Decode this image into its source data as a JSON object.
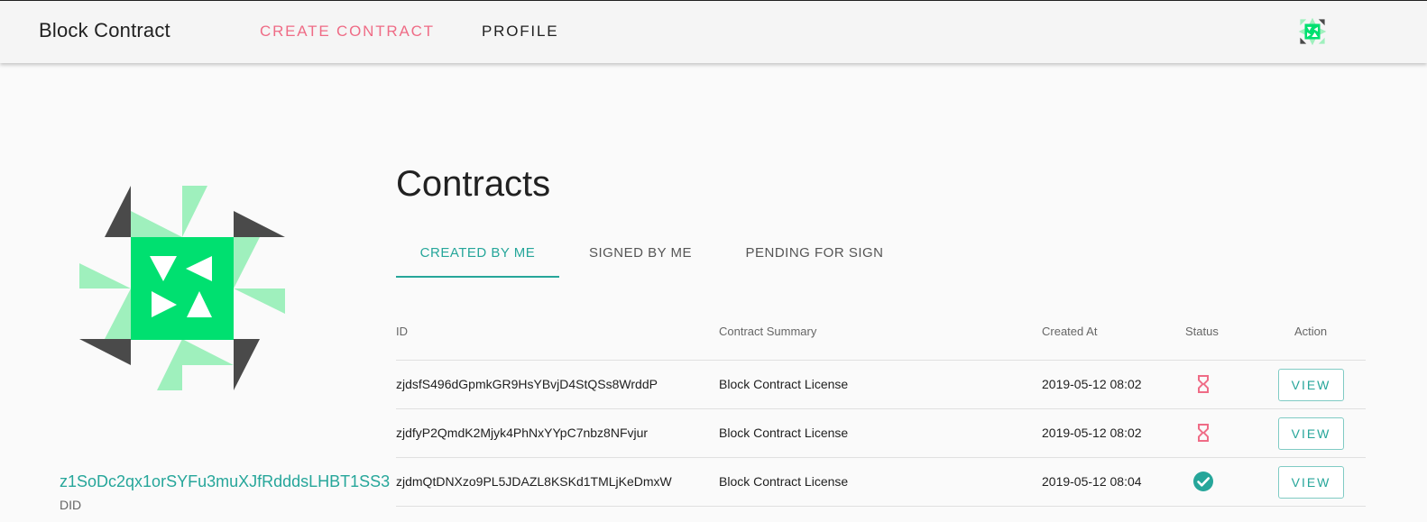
{
  "appbar": {
    "brand": "Block Contract",
    "nav": {
      "create_contract": "CREATE CONTRACT",
      "profile": "PROFILE"
    }
  },
  "profile": {
    "did_value": "z1SoDc2qx1orSYFu3muXJfRdddsLHBT1SS3",
    "did_label": "DID"
  },
  "page": {
    "title": "Contracts",
    "tabs": [
      {
        "label": "CREATED BY ME",
        "active": true
      },
      {
        "label": "SIGNED BY ME",
        "active": false
      },
      {
        "label": "PENDING FOR SIGN",
        "active": false
      }
    ]
  },
  "table": {
    "headers": [
      "ID",
      "Contract Summary",
      "Created At",
      "Status",
      "Action"
    ],
    "rows": [
      {
        "id": "zjdsfS496dGpmkGR9HsYBvjD4StQSs8WrddP",
        "summary": "Block Contract License",
        "created_at": "2019-05-12 08:02",
        "status": "pending",
        "status_icon": "hourglass-icon",
        "action": "VIEW"
      },
      {
        "id": "zjdfyP2QmdK2Mjyk4PhNxYYpC7nbz8NFvjur",
        "summary": "Block Contract License",
        "created_at": "2019-05-12 08:02",
        "status": "pending",
        "status_icon": "hourglass-icon",
        "action": "VIEW"
      },
      {
        "id": "zjdmQtDNXzo9PL5JDAZL8KSKd1TMLjKeDmxW",
        "summary": "Block Contract License",
        "created_at": "2019-05-12 08:04",
        "status": "signed",
        "status_icon": "check-circle-icon",
        "action": "VIEW"
      }
    ]
  },
  "colors": {
    "accent": "#26a69a",
    "nav_active": "#ef6c86",
    "pending_icon": "#ef6c86",
    "signed_icon": "#26a69a",
    "identicon_main": "#00e070",
    "identicon_light": "#9ff0bd",
    "identicon_dark": "#4a4a4a"
  }
}
